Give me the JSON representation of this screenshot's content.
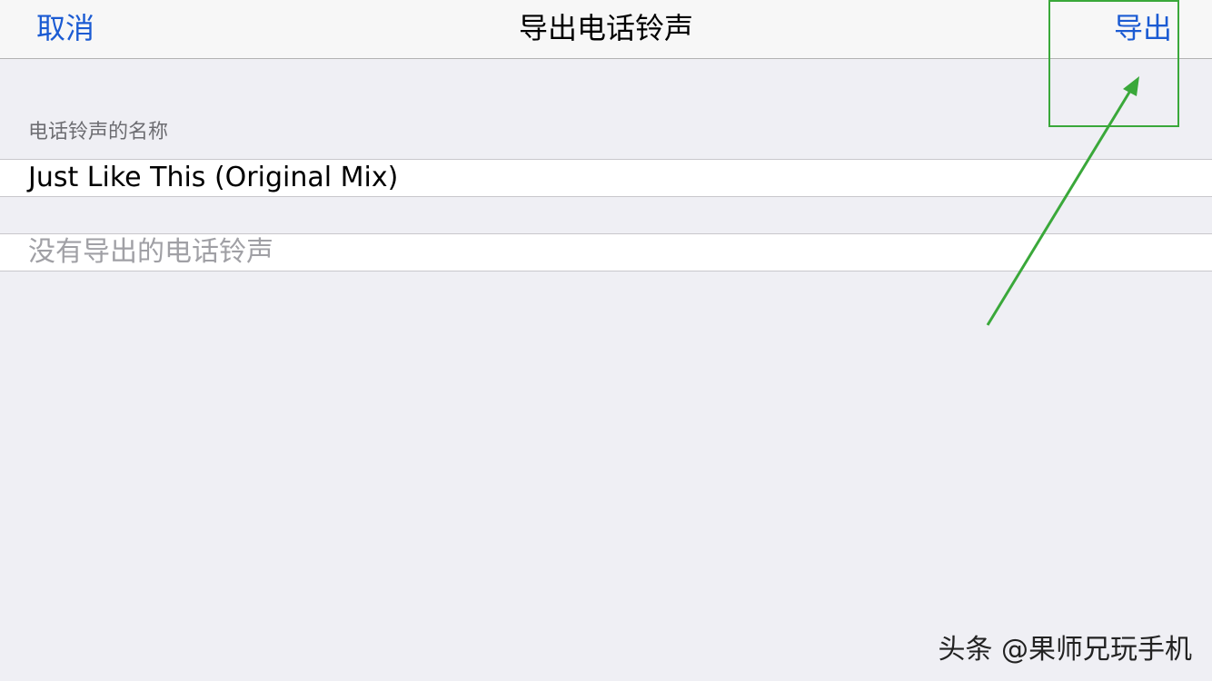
{
  "navbar": {
    "cancel_label": "取消",
    "title": "导出电话铃声",
    "export_label": "导出"
  },
  "form": {
    "section_header": "电话铃声的名称",
    "ringtone_name": "Just Like This (Original Mix)",
    "empty_list_text": "没有导出的电话铃声"
  },
  "annotation": {
    "color": "#3aa83a"
  },
  "watermark": {
    "text": "头条 @果师兄玩手机"
  },
  "colors": {
    "accent": "#1b5bd3",
    "background": "#efeff4",
    "navbar": "#f7f7f7"
  }
}
